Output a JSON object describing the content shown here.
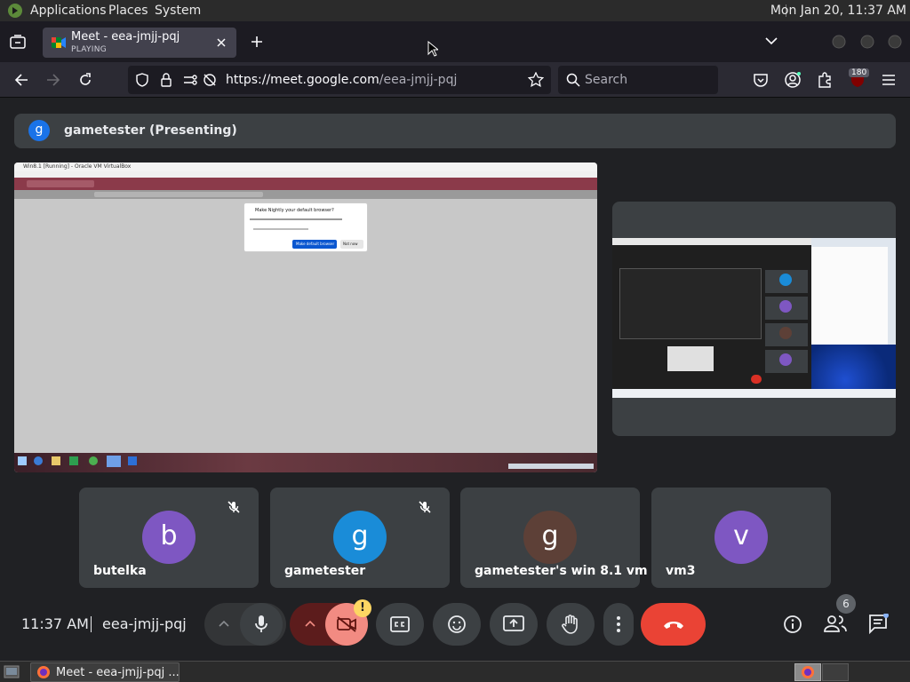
{
  "top_panel": {
    "menus": [
      "Applications",
      "Places",
      "System"
    ],
    "clock": "Mon Jan 20, 11:37 AM"
  },
  "browser": {
    "tab": {
      "title": "Meet - eea-jmjj-pqj",
      "status": "PLAYING"
    },
    "url": {
      "host": "https://meet.google.com",
      "path": "/eea-jmjj-pqj"
    },
    "search_placeholder": "Search",
    "extension_badge": "180"
  },
  "meet": {
    "presenter": {
      "initial": "g",
      "label": "gametester (Presenting)"
    },
    "participants": [
      {
        "initial": "b",
        "name": "butelka",
        "color": "#7e57c2",
        "muted": true
      },
      {
        "initial": "g",
        "name": "gametester",
        "color": "#1a8cd8",
        "muted": true
      },
      {
        "initial": "g",
        "name": "gametester's win 8.1 vm",
        "color": "#5d4037",
        "muted": false
      },
      {
        "initial": "v",
        "name": "vm3",
        "color": "#7e57c2",
        "muted": false
      }
    ],
    "controls": {
      "time": "11:37 AM",
      "meeting_code": "eea-jmjj-pqj",
      "people_count": "6",
      "camera_warning": "!"
    },
    "shared_screen": {
      "window_title": "Win8.1 [Running] - Oracle VM VirtualBox",
      "dialog_title": "Make Nightly your default browser?",
      "dialog_primary": "Make default browser",
      "dialog_secondary": "Not now"
    }
  },
  "taskbar": {
    "task_label": "Meet - eea-jmjj-pqj ..."
  },
  "colors": {
    "accent": "#1a73e8",
    "end_call": "#ea4335",
    "camera_off": "#f28b82"
  }
}
